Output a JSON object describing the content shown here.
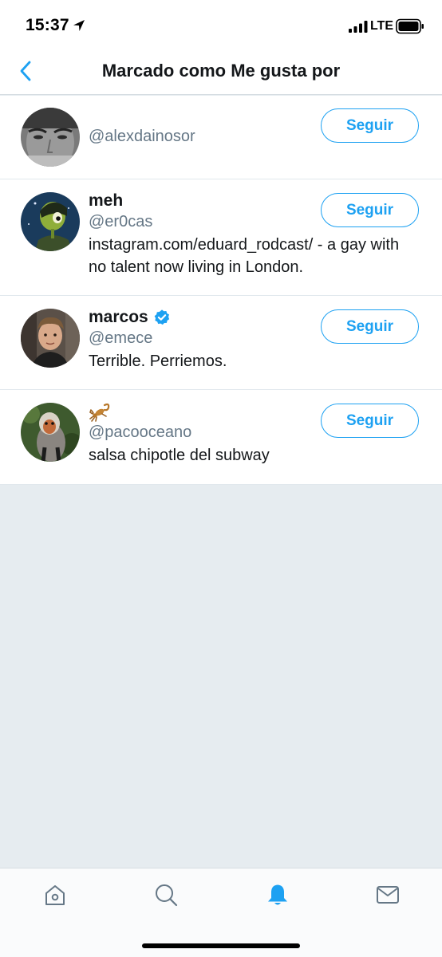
{
  "status_bar": {
    "time": "15:37",
    "network": "LTE",
    "icons": [
      "location-arrow-icon",
      "signal-bars-icon",
      "battery-icon"
    ]
  },
  "header": {
    "title": "Marcado como Me gusta por",
    "back_icon": "chevron-left-icon"
  },
  "users": [
    {
      "name": "",
      "handle": "@alexdainosor",
      "bio": "",
      "verified": false,
      "follow_label": "Seguir"
    },
    {
      "name": "meh",
      "handle": "@er0cas",
      "bio": "instagram.com/eduard_rodcast/ - a gay with no talent now living in London.",
      "verified": false,
      "follow_label": "Seguir"
    },
    {
      "name": "marcos",
      "handle": "@emece",
      "bio": "Terrible. Perriemos.",
      "verified": true,
      "follow_label": "Seguir"
    },
    {
      "name": "",
      "handle": "@pacooceano",
      "bio": "salsa chipotle del subway",
      "verified": false,
      "name_icon": "scorpion-icon",
      "follow_label": "Seguir"
    }
  ],
  "tab_bar": {
    "items": [
      "home-icon",
      "search-icon",
      "notifications-bell-icon",
      "messages-envelope-icon"
    ],
    "active": "notifications-bell-icon"
  },
  "colors": {
    "accent": "#1da1f2",
    "text_primary": "#14171a",
    "text_secondary": "#657786",
    "background": "#e6ecf0"
  }
}
